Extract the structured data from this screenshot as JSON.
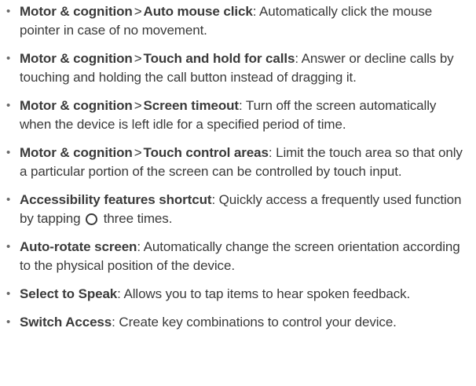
{
  "items": [
    {
      "bullet": "•",
      "menu": "Motor & cognition",
      "separator": ">",
      "title": "Auto mouse click",
      "colon": ":",
      "description": " Automatically click the mouse pointer in case of no movement."
    },
    {
      "bullet": "•",
      "menu": "Motor & cognition",
      "separator": ">",
      "title": "Touch and hold for calls",
      "colon": ":",
      "description": " Answer or decline calls by touching and holding the call button instead of dragging it."
    },
    {
      "bullet": "•",
      "menu": "Motor & cognition",
      "separator": ">",
      "title": "Screen timeout",
      "colon": ":",
      "description": " Turn off the screen automatically when the device is left idle for a specified period of time."
    },
    {
      "bullet": "•",
      "menu": "Motor & cognition",
      "separator": ">",
      "title": "Touch control areas",
      "colon": ":",
      "description": " Limit the touch area so that only a particular portion of the screen can be controlled by touch input."
    },
    {
      "bullet": "•",
      "title": "Accessibility features shortcut",
      "colon": ":",
      "description_before_icon": " Quickly access a frequently used function by tapping",
      "icon": "home-button-circle-icon",
      "description_after_icon": " three times."
    },
    {
      "bullet": "•",
      "title": "Auto-rotate screen",
      "colon": ":",
      "description": " Automatically change the screen orientation according to the physical position of the device."
    },
    {
      "bullet": "•",
      "title": "Select to Speak",
      "colon": ":",
      "description": " Allows you to tap items to hear spoken feedback."
    },
    {
      "bullet": "•",
      "title": "Switch Access",
      "colon": ":",
      "description": " Create key combinations to control your device."
    }
  ]
}
